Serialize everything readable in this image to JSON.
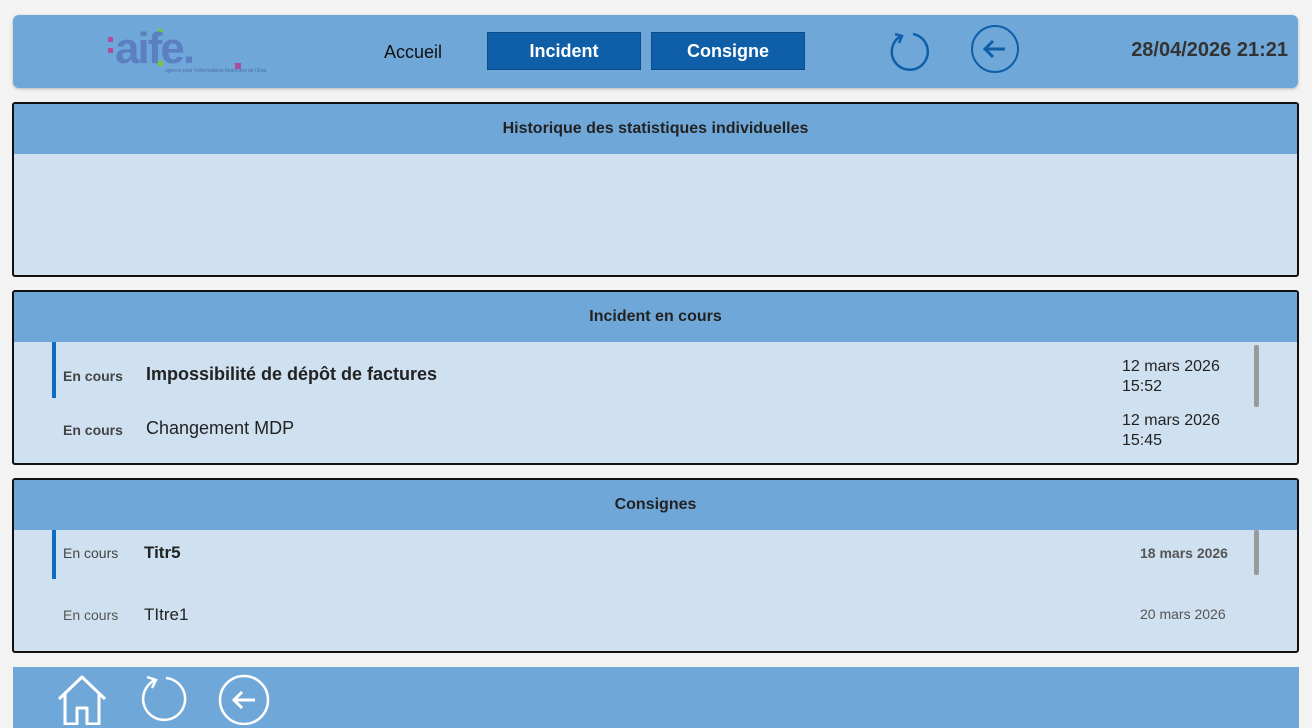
{
  "header": {
    "logo": {
      "text": "aife.",
      "subtitle": "agence pour l'informatique financière de l'État"
    },
    "nav": {
      "home": "Accueil",
      "incident": "Incident",
      "consigne": "Consigne"
    },
    "icons": {
      "refresh": "refresh-icon",
      "back": "back-arrow-icon"
    },
    "datetime": "28/04/2026 21:21"
  },
  "stats_panel": {
    "title": "Historique des statistiques individuelles"
  },
  "incidents_panel": {
    "title": "Incident en cours",
    "items": [
      {
        "status": "En cours",
        "title": "Impossibilité de dépôt de factures",
        "date": "12 mars 2026",
        "time": "15:52"
      },
      {
        "status": "En cours",
        "title": "Changement MDP",
        "date": "12 mars 2026",
        "time": "15:45"
      }
    ]
  },
  "consignes_panel": {
    "title": "Consignes",
    "items": [
      {
        "status": "En cours",
        "title": "Titr5",
        "date": "18 mars 2026"
      },
      {
        "status": "En cours",
        "title": "TItre1",
        "date": "20 mars 2026"
      }
    ]
  },
  "footer": {
    "icons": {
      "home": "home-icon",
      "refresh": "refresh-icon",
      "back": "back-arrow-icon"
    }
  },
  "colors": {
    "header_bg": "#6fa8d8",
    "button_bg": "#0e5fa8",
    "panel_bg": "#cfe1f0",
    "accent": "#0e6cc0"
  }
}
